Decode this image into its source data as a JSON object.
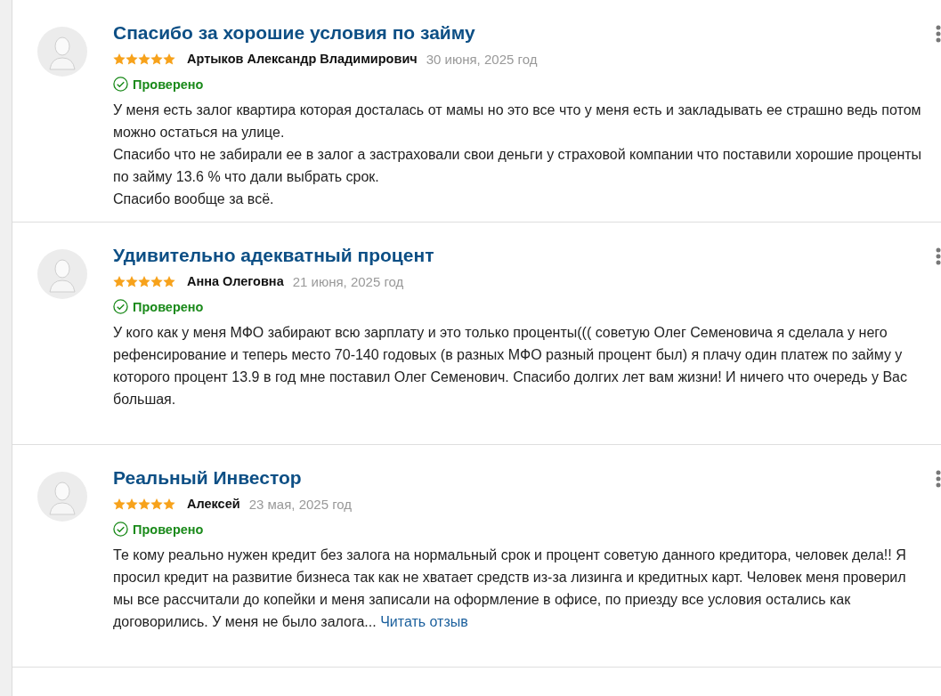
{
  "reviews": [
    {
      "title": "Спасибо за хорошие условия по займу",
      "stars": 5,
      "author": "Артыков Александр Владимирович",
      "date": "30 июня, 2025 год",
      "verified": true,
      "verified_label": "Проверено",
      "paragraphs": [
        "У меня есть залог квартира которая досталась от мамы но это все что у меня есть и закладывать ее страшно ведь потом можно остаться на улице.",
        "Спасибо что не забирали ее в залог а застраховали свои деньги у страховой компании что поставили хорошие проценты по займу 13.6 % что дали выбрать срок.",
        "Спасибо вообще за всё."
      ]
    },
    {
      "title": "Удивительно адекватный процент",
      "stars": 5,
      "author": "Анна Олеговна",
      "date": "21 июня, 2025 год",
      "verified": true,
      "verified_label": "Проверено",
      "paragraphs": [
        "У кого как у меня МФО забирают всю зарплату и это только проценты((( советую Олег Семеновича я сделала у него рефенсирование и теперь место 70-140 годовых (в разных МФО разный процент был) я плачу один платеж по займу у которого процент 13.9 в год мне поставил Олег Семенович. Спасибо долгих лет вам жизни! И ничего что очередь у Вас большая."
      ]
    },
    {
      "title": "Реальный Инвестор",
      "stars": 5,
      "author": "Алексей",
      "date": "23 мая, 2025 год",
      "verified": true,
      "verified_label": "Проверено",
      "paragraphs": [
        "Те кому реально нужен кредит без залога на нормальный срок и процент советую данного кредитора, человек дела!! Я просил кредит на развитие бизнеса так как не хватает средств из-за лизинга и кредитных карт. Человек меня проверил мы все рассчитали до копейки и меня записали на оформление в офисе, по приезду все условия остались как договорились. У меня не было залога..."
      ],
      "more_link": "Читать отзыв"
    }
  ]
}
